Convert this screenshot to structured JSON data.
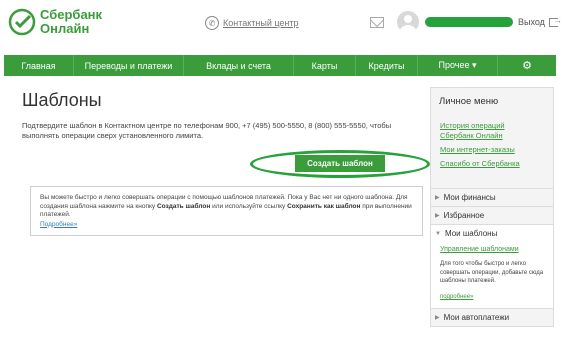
{
  "header": {
    "logo_line1": "Сбербанк",
    "logo_line2": "Онлайн",
    "contact_label": "Контактный центр",
    "exit_label": "Выход"
  },
  "nav": {
    "items": [
      {
        "label": "Главная"
      },
      {
        "label": "Переводы и платежи"
      },
      {
        "label": "Вклады и счета"
      },
      {
        "label": "Карты"
      },
      {
        "label": "Кредиты"
      },
      {
        "label": "Прочее ▾"
      }
    ]
  },
  "main": {
    "title": "Шаблоны",
    "intro": "Подтвердите шаблон в Контактном центре по телефонам 900, +7 (495) 500-5550, 8 (800) 555-5550, чтобы выполнять операции сверх установленного лимита.",
    "create_button": "Создать шаблон",
    "info": {
      "part1": "Вы можете быстро и легко совершать операции с помощью шаблонов платежей. Пока у Вас нет ни одного шаблона. Для создания шаблона нажмите на кнопку ",
      "bold1": "Создать шаблон",
      "part2": " или используйте ссылку ",
      "bold2": "Сохранить как шаблон",
      "part3": " при выполнении платежей.",
      "link": "Подробнее»"
    }
  },
  "sidebar": {
    "title": "Личное меню",
    "links": [
      "История операций Сбербанк Онлайн",
      "Мои интернет-заказы",
      "Спасибо от Сбербанка"
    ],
    "sections": [
      {
        "label": "Мои финансы"
      },
      {
        "label": "Избранное"
      },
      {
        "label": "Мои шаблоны"
      },
      {
        "label": "Мои автоплатежи"
      }
    ],
    "templates_manage": "Управление шаблонами",
    "templates_text": "Для того чтобы быстро и легко совершать операции, добавьте сюда шаблоны платежей.",
    "templates_more": "подробнее»"
  }
}
